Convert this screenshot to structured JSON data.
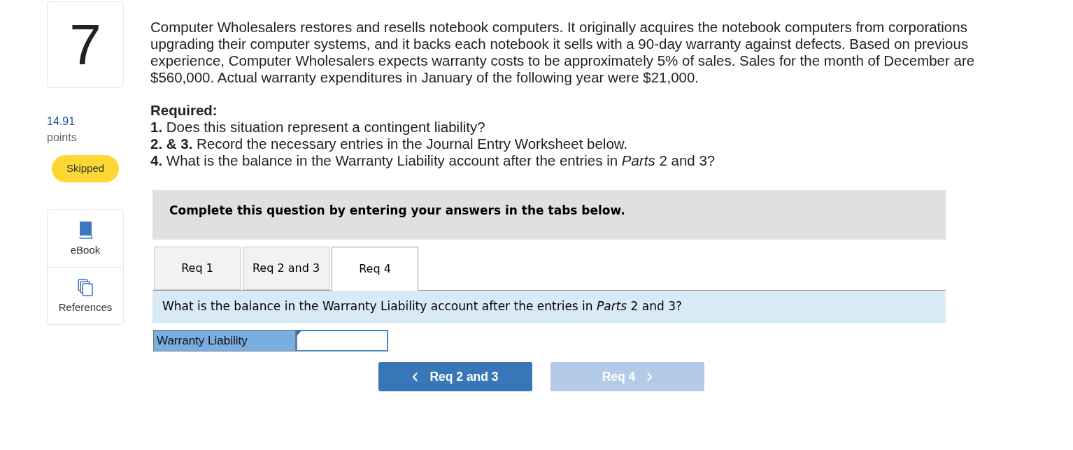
{
  "question": {
    "number": "7",
    "points": "14.91",
    "points_label": "points",
    "status": "Skipped"
  },
  "tools": [
    {
      "kind": "ebook",
      "label": "eBook"
    },
    {
      "kind": "references",
      "label": "References"
    }
  ],
  "problem": {
    "text": "Computer Wholesalers restores and resells notebook computers. It originally acquires the notebook computers from corporations upgrading their computer systems, and it backs each notebook it sells with a 90-day warranty against defects. Based on previous experience, Computer Wholesalers expects warranty costs to be approximately 5% of sales. Sales for the month of December are $560,000. Actual warranty expenditures in January of the following year were $21,000.",
    "required_heading": "Required:",
    "requirements": [
      "**1.** Does this situation represent a contingent liability?",
      "**2. & 3.** Record the necessary entries in the Journal Entry Worksheet below.",
      "**4.** What is the balance in the Warranty Liability account after the entries in *Parts* 2 and 3?"
    ]
  },
  "instruction": "Complete this question by entering your answers in the tabs below.",
  "tabs": [
    {
      "label": "Req 1",
      "selected": false
    },
    {
      "label": "Req 2 and 3",
      "selected": false
    },
    {
      "label": "Req 4",
      "selected": true
    }
  ],
  "prompt": "What is the balance in the Warranty Liability account after the entries in *Parts* 2 and 3?",
  "answer_row": {
    "label": "Warranty Liability"
  },
  "nav": [
    {
      "kind": "prev",
      "label": "Req 2 and 3",
      "disabled": false
    },
    {
      "kind": "next",
      "label": "Req 4",
      "disabled": true
    }
  ]
}
